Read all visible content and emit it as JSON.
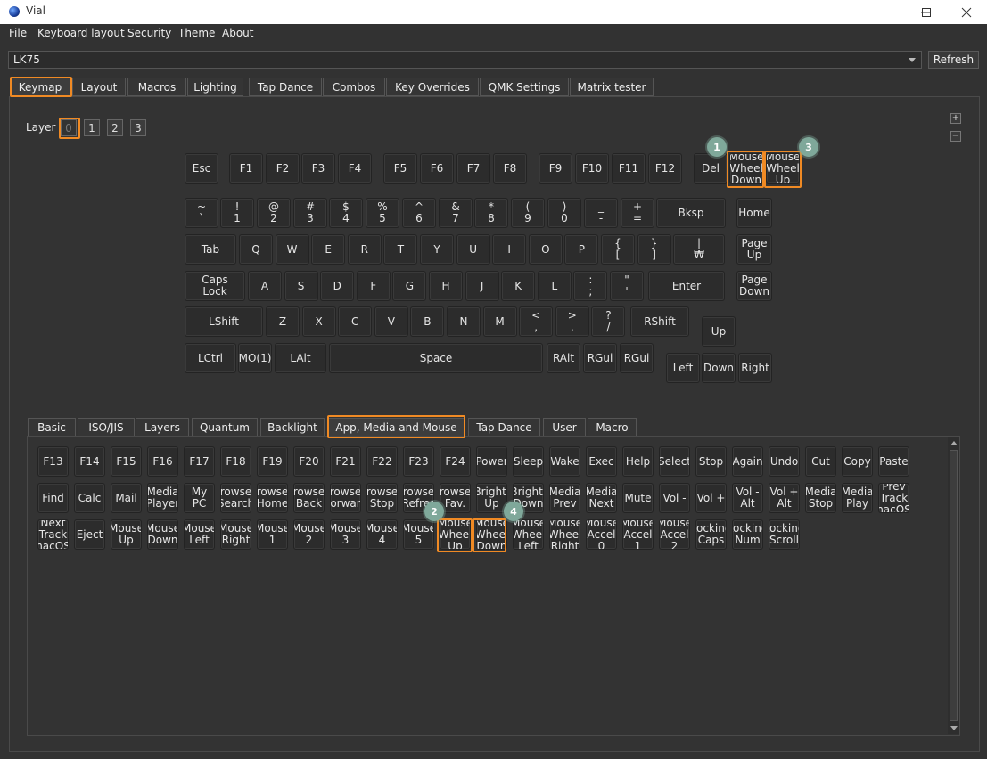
{
  "window": {
    "title": "Vial"
  },
  "menu": [
    "File",
    "Keyboard layout",
    "Security",
    "Theme",
    "About"
  ],
  "device": {
    "selected": "LK75",
    "refresh_label": "Refresh"
  },
  "main_tabs": [
    "Keymap",
    "Layout",
    "Macros",
    "Lighting",
    "Tap Dance",
    "Combos",
    "Key Overrides",
    "QMK Settings",
    "Matrix tester"
  ],
  "active_main_tab": "Keymap",
  "layers": {
    "label": "Layer",
    "items": [
      "0",
      "1",
      "2",
      "3"
    ],
    "selected": "0"
  },
  "zoom": {
    "in": "+",
    "out": "−"
  },
  "keyboard_keys": [
    "Esc",
    "F1",
    "F2",
    "F3",
    "F4",
    "F5",
    "F6",
    "F7",
    "F8",
    "F9",
    "F10",
    "F11",
    "F12",
    "Del",
    "Mouse\nWheel\nDown",
    "Mouse\nWheel\nUp",
    "~\n`",
    "!\n1",
    "@\n2",
    "#\n3",
    "$\n4",
    "%\n5",
    "^\n6",
    "&\n7",
    "*\n8",
    "(\n9",
    ")\n0",
    "_\n-",
    "+\n=",
    "Bksp",
    "Home",
    "Tab",
    "Q",
    "W",
    "E",
    "R",
    "T",
    "Y",
    "U",
    "I",
    "O",
    "P",
    "{\n[",
    "}\n]",
    "|\n₩",
    "Page\nUp",
    "Caps\nLock",
    "A",
    "S",
    "D",
    "F",
    "G",
    "H",
    "J",
    "K",
    "L",
    ":\n;",
    "\"\n'",
    "Enter",
    "Page\nDown",
    "LShift",
    "Z",
    "X",
    "C",
    "V",
    "B",
    "N",
    "M",
    "<\n,",
    ">\n.",
    "?\n/",
    "RShift",
    "Up",
    "LCtrl",
    "MO(1)",
    "LAlt",
    "Space",
    "RAlt",
    "RGui",
    "RGui",
    "Left",
    "Down",
    "Right"
  ],
  "sub_tabs": [
    "Basic",
    "ISO/JIS",
    "Layers",
    "Quantum",
    "Backlight",
    "App, Media and Mouse",
    "Tap Dance",
    "User",
    "Macro"
  ],
  "active_sub_tab": "App, Media and Mouse",
  "palette_keys": [
    "F13",
    "F14",
    "F15",
    "F16",
    "F17",
    "F18",
    "F19",
    "F20",
    "F21",
    "F22",
    "F23",
    "F24",
    "Power",
    "Sleep",
    "Wake",
    "Exec",
    "Help",
    "Select",
    "Stop",
    "Again",
    "Undo",
    "Cut",
    "Copy",
    "Paste",
    "Find",
    "Calc",
    "Mail",
    "Media\nPlayer",
    "My\nPC",
    "rowse\nSearch",
    "rowse\nHome",
    "rowse\nBack",
    "rowse\norwar",
    "rowse\nStop",
    "rowse\nRefres",
    "rowse\nFav.",
    "Bright.\nUp",
    "Bright.\nDown",
    "Media\nPrev",
    "Media\nNext",
    "Mute",
    "Vol -",
    "Vol +",
    "Vol -\nAlt",
    "Vol +\nAlt",
    "Media\nStop",
    "Media\nPlay",
    "Prev\nTrack\nnacOS",
    "Next\nTrack\nnacOS",
    "Eject",
    "Mouse\nUp",
    "Mouse\nDown",
    "Mouse\nLeft",
    "Mouse\nRight",
    "Mouse\n1",
    "Mouse\n2",
    "Mouse\n3",
    "Mouse\n4",
    "Mouse\n5",
    "Mouse\nWheel\nUp",
    "Mouse\nWheel\nDown",
    "Mouse\nWheel\nLeft",
    "Mouse\nWheel\nRight",
    "Mouse\nAccel\n0",
    "Mouse\nAccel\n1",
    "Mouse\nAccel\n2",
    "Locking\nCaps",
    "Locking\nNum",
    "Locking\nScroll"
  ],
  "annotations": [
    "1",
    "2",
    "3",
    "4"
  ],
  "highlight_color": "#f08a24",
  "badge_color": "#7fa89a"
}
